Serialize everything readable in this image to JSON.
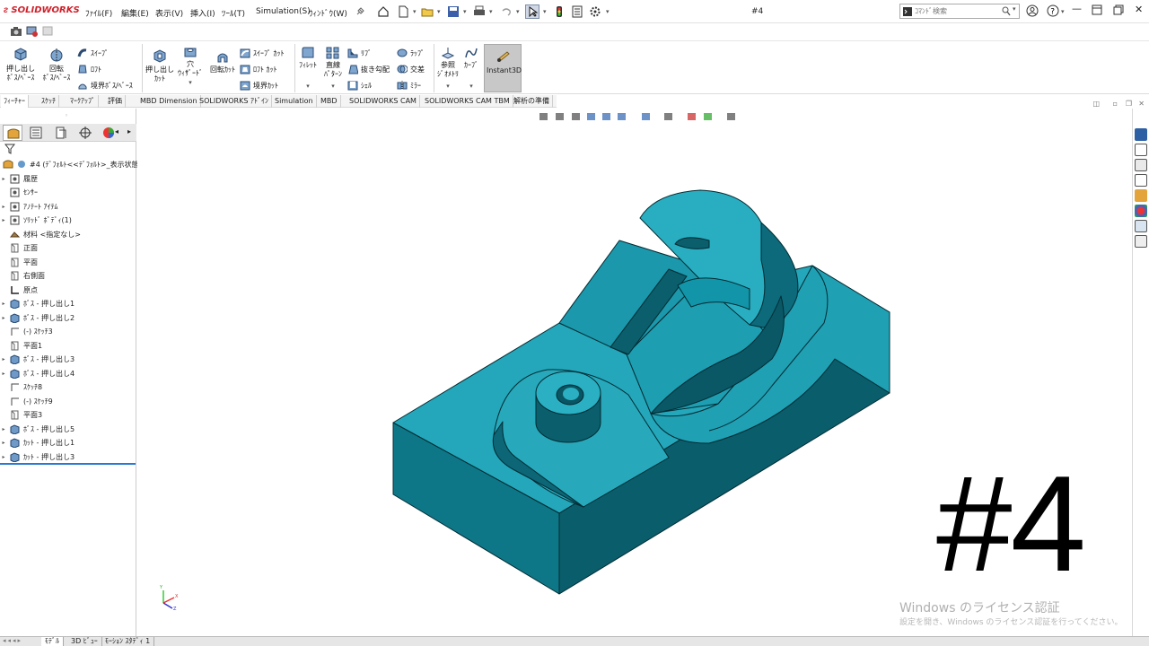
{
  "app": {
    "logo": "SOLIDWORKS",
    "document_title": "#4"
  },
  "menu": [
    "ﾌｧｲﾙ(F)",
    "編集(E)",
    "表示(V)",
    "挿入(I)",
    "ﾂｰﾙ(T)",
    "Simulation(S)",
    "ｳｨﾝﾄﾞｳ(W)"
  ],
  "search": {
    "placeholder": "ｺﾏﾝﾄﾞ検索"
  },
  "ribbon": {
    "extrude_boss": "押し出し\nﾎﾞｽ/ﾍﾞｰｽ",
    "revolve_boss": "回転\nﾎﾞｽ/ﾍﾞｰｽ",
    "sweep": "ｽｲｰﾌﾟ",
    "loft": "ﾛﾌﾄ",
    "boundary_boss": "境界ﾎﾞｽ/ﾍﾞｰｽ",
    "extrude_cut": "押し出し\nｶｯﾄ",
    "hole_wizard": "穴\nｳｨｻﾞｰﾄﾞ",
    "revolve_cut": "回転ｶｯﾄ",
    "sweep_cut": "ｽｲｰﾌﾟ ｶｯﾄ",
    "loft_cut": "ﾛﾌﾄ ｶｯﾄ",
    "boundary_cut": "境界ｶｯﾄ",
    "fillet": "ﾌｨﾚｯﾄ",
    "linear_pattern": "直線\nﾊﾟﾀｰﾝ",
    "rib": "ﾘﾌﾞ",
    "draft": "抜き勾配",
    "shell": "ｼｪﾙ",
    "wrap": "ﾗｯﾌﾟ",
    "intersect": "交差",
    "mirror": "ﾐﾗｰ",
    "ref_geometry": "参照\nｼﾞｵﾒﾄﾘ",
    "curves": "ｶｰﾌﾞ",
    "instant3d": "Instant3D"
  },
  "tabs": [
    "ﾌｨｰﾁｬｰ",
    "ｽｹｯﾁ",
    "ﾏｰｸｱｯﾌﾟ",
    "評価",
    "MBD Dimension",
    "SOLIDWORKS ｱﾄﾞｲﾝ",
    "Simulation",
    "MBD",
    "SOLIDWORKS CAM",
    "SOLIDWORKS CAM TBM",
    "解析の準備"
  ],
  "tree": {
    "root": "#4 (ﾃﾞﾌｫﾙﾄ<<ﾃﾞﾌｫﾙﾄ>_表示状態",
    "items": [
      {
        "label": "履歴",
        "expandable": true
      },
      {
        "label": "ｾﾝｻｰ",
        "expandable": false
      },
      {
        "label": "ｱﾉﾃｰﾄ ｱｲﾃﾑ",
        "expandable": true
      },
      {
        "label": "ｿﾘｯﾄﾞ ﾎﾞﾃﾞｨ(1)",
        "expandable": true
      },
      {
        "label": "材料 <指定なし>",
        "expandable": false
      },
      {
        "label": "正面",
        "expandable": false
      },
      {
        "label": "平面",
        "expandable": false
      },
      {
        "label": "右側面",
        "expandable": false
      },
      {
        "label": "原点",
        "expandable": false
      },
      {
        "label": "ﾎﾞｽ - 押し出し1",
        "expandable": true
      },
      {
        "label": "ﾎﾞｽ - 押し出し2",
        "expandable": true
      },
      {
        "label": "(-) ｽｹｯﾁ3",
        "expandable": false
      },
      {
        "label": "平面1",
        "expandable": false
      },
      {
        "label": "ﾎﾞｽ - 押し出し3",
        "expandable": true
      },
      {
        "label": "ﾎﾞｽ - 押し出し4",
        "expandable": true
      },
      {
        "label": "ｽｹｯﾁ8",
        "expandable": false
      },
      {
        "label": "(-) ｽｹｯﾁ9",
        "expandable": false
      },
      {
        "label": "平面3",
        "expandable": false
      },
      {
        "label": "ﾎﾞｽ - 押し出し5",
        "expandable": true
      },
      {
        "label": "ｶｯﾄ - 押し出し1",
        "expandable": true
      },
      {
        "label": "ｶｯﾄ - 押し出し3",
        "expandable": true
      }
    ]
  },
  "overlay": {
    "big_label": "#4"
  },
  "watermark": {
    "line1": "Windows のライセンス認証",
    "line2": "設定を開き、Windows のライセンス認証を行ってください。"
  },
  "bottom_tabs": [
    "ﾓﾃﾞﾙ",
    "3D ﾋﾞｭｰ",
    "ﾓｰｼｮﾝ ｽﾀﾃﾞｨ 1"
  ],
  "colors": {
    "model_top": "#20a2b6",
    "model_front": "#0b6f80",
    "model_side": "#0c5c6b",
    "brand": "#d0202a"
  }
}
